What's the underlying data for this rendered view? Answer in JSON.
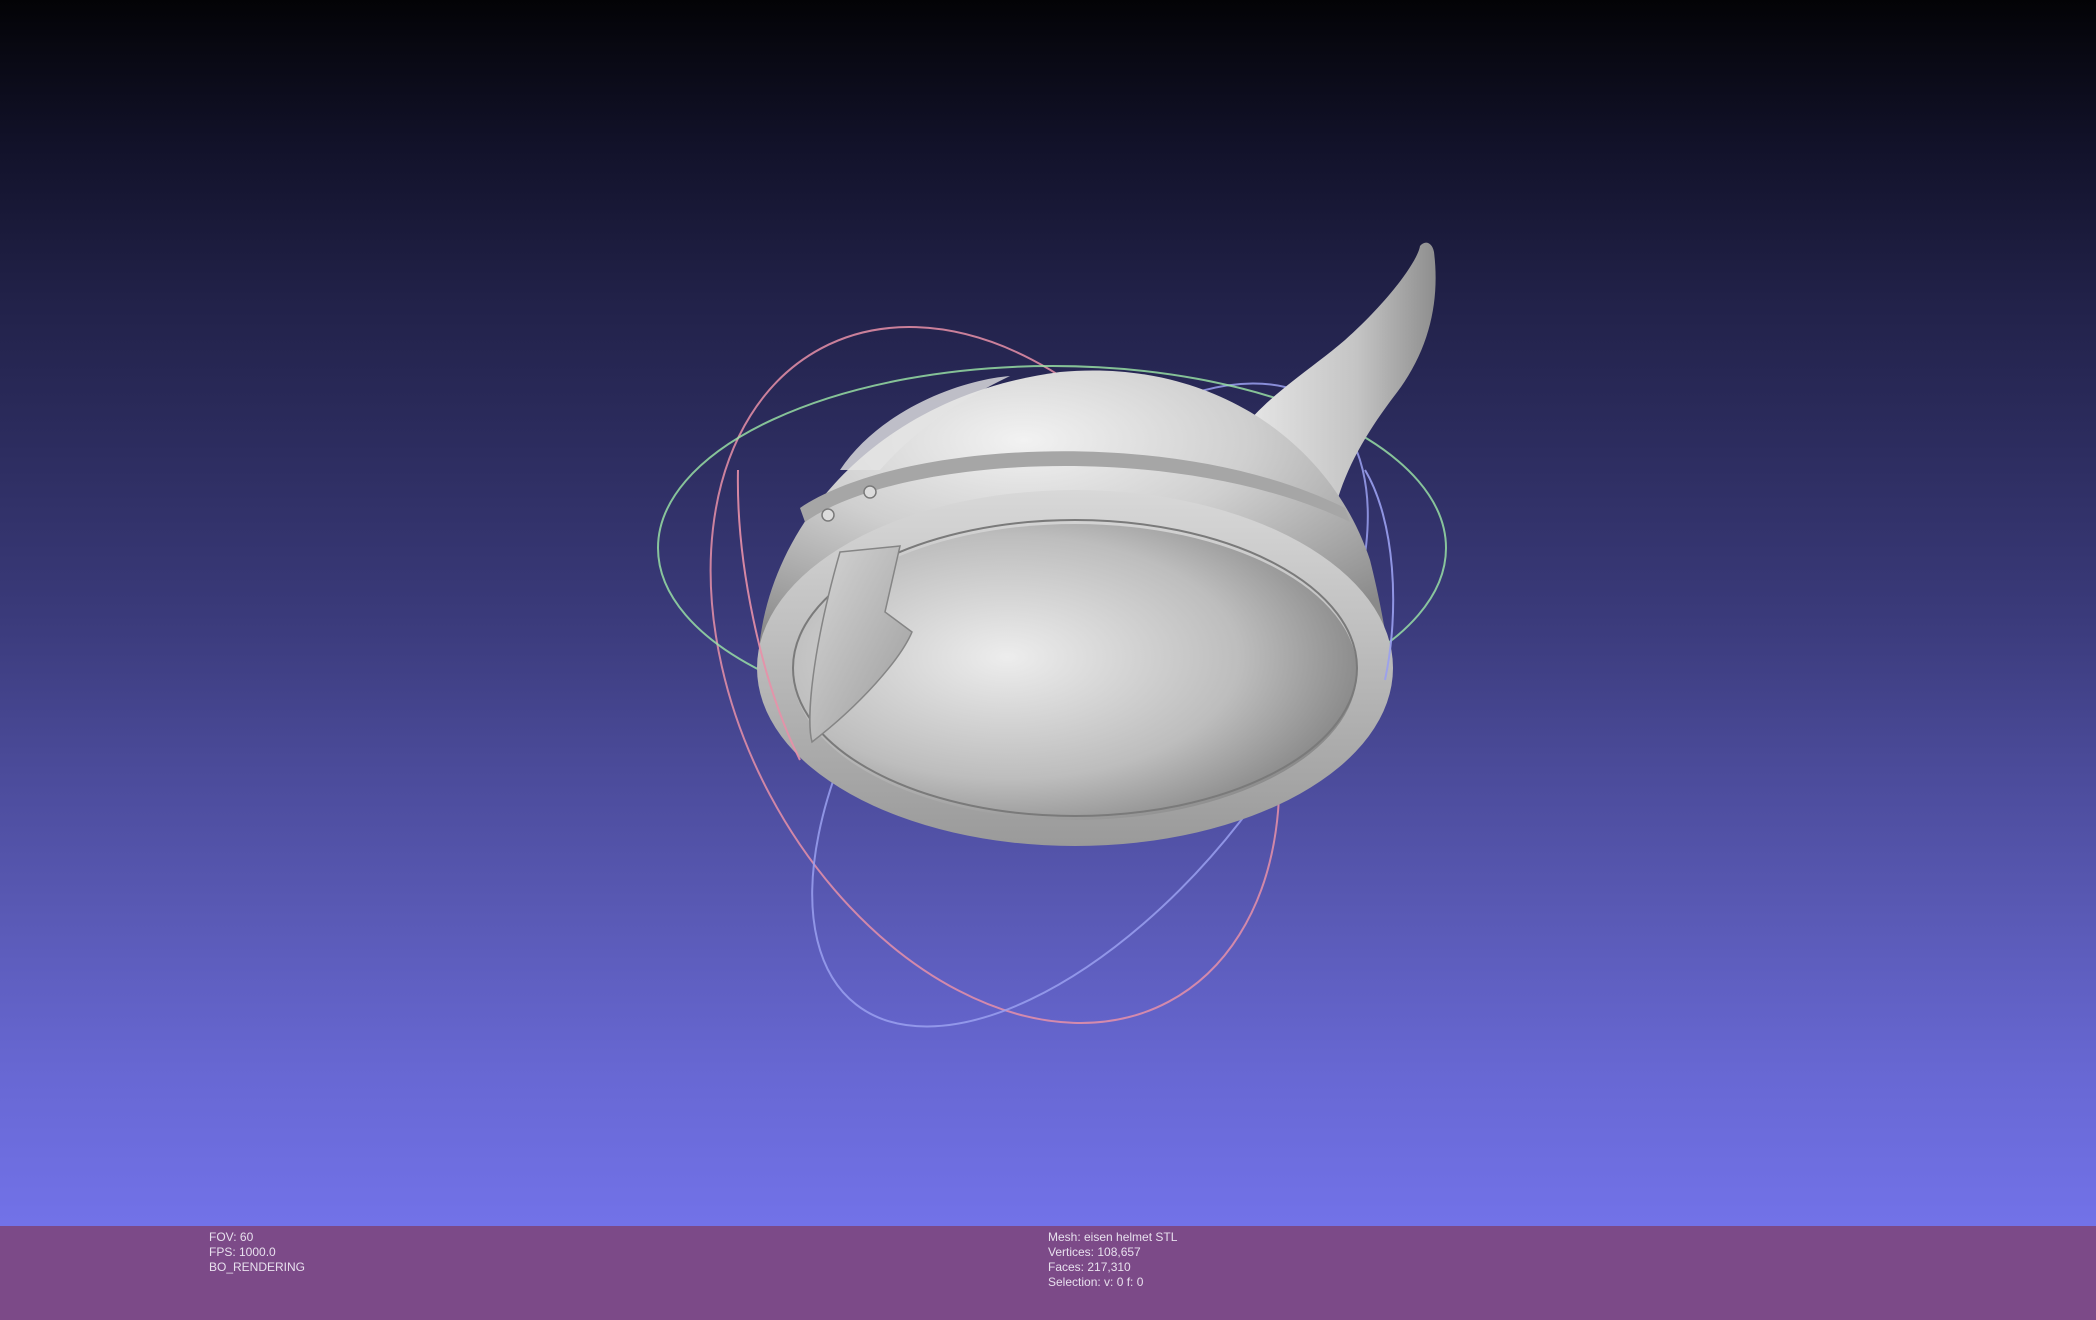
{
  "viewer": {
    "left_info": {
      "fov": "FOV: 60",
      "fps": "FPS:  1000.0",
      "mode": "BO_RENDERING"
    },
    "right_info": {
      "mesh": "Mesh: eisen helmet STL",
      "vertices": "Vertices: 108,657",
      "faces": "Faces: 217,310",
      "selection": "Selection: v: 0 f: 0"
    }
  },
  "colors": {
    "infobar_bg": "#7c4a88",
    "model": "#c8c8c8",
    "trackball_red": "#e890a8",
    "trackball_green": "#9ee8a8",
    "trackball_blue": "#9aa0f0"
  }
}
